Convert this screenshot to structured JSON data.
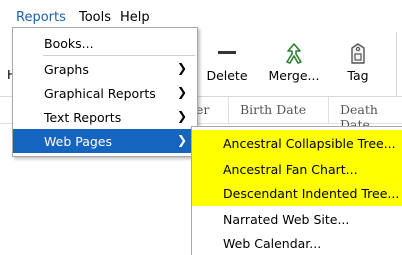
{
  "menubar": {
    "items": [
      "Reports",
      "Tools",
      "Help"
    ]
  },
  "toolbar": {
    "partial_left": "H",
    "buttons": [
      {
        "label": "Delete",
        "icon": "minus-icon"
      },
      {
        "label": "Merge...",
        "icon": "merge-icon"
      },
      {
        "label": "Tag",
        "icon": "tag-icon"
      }
    ]
  },
  "columns": {
    "partial_left": "er",
    "headers": [
      "Birth Date",
      "Death Date"
    ]
  },
  "reports_menu": {
    "items": [
      {
        "label": "Books...",
        "has_submenu": false
      },
      {
        "label": "Graphs",
        "has_submenu": true
      },
      {
        "label": "Graphical Reports",
        "has_submenu": true
      },
      {
        "label": "Text Reports",
        "has_submenu": true
      },
      {
        "label": "Web Pages",
        "has_submenu": true,
        "selected": true
      }
    ],
    "arrow_glyph": "❯"
  },
  "web_pages_submenu": {
    "items": [
      {
        "label": "Ancestral Collapsible Tree...",
        "highlighted": true
      },
      {
        "label": "Ancestral Fan Chart...",
        "highlighted": true
      },
      {
        "label": "Descendant Indented Tree...",
        "highlighted": true
      },
      {
        "label": "Narrated Web Site...",
        "highlighted": false
      },
      {
        "label": "Web Calendar...",
        "highlighted": false
      }
    ]
  },
  "colors": {
    "menu_selected_bg": "#1565c0",
    "highlight_bg": "#ffff00",
    "active_menu_text": "#1a5fb4"
  }
}
